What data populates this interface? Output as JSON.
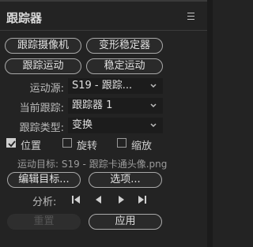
{
  "panel": {
    "title": "跟踪器",
    "menu_icon": "hamburger-menu-icon"
  },
  "buttons": {
    "track_camera": "跟踪摄像机",
    "warp_stabilizer": "变形稳定器",
    "track_motion": "跟踪运动",
    "stabilize_motion": "稳定运动"
  },
  "fields": {
    "motion_source_label": "运动源:",
    "motion_source_value": "S19 - 跟踪...",
    "current_tracker_label": "当前跟踪:",
    "current_tracker_value": "跟踪器 1",
    "track_type_label": "跟踪类型:",
    "track_type_value": "变换"
  },
  "checkboxes": [
    {
      "label": "位置",
      "checked": true
    },
    {
      "label": "旋转",
      "checked": false
    },
    {
      "label": "缩放",
      "checked": false
    }
  ],
  "motion_target": "运动目标: S19 - 跟踪卡通头像.png",
  "buttons2": {
    "edit_target": "编辑目标...",
    "options": "选项..."
  },
  "analyze": {
    "label": "分析:",
    "icons": [
      "step-back-to-start-icon",
      "play-backward-icon",
      "play-forward-icon",
      "step-forward-icon"
    ]
  },
  "bottom": {
    "reset": "重置",
    "apply": "应用",
    "reset_enabled": false
  }
}
